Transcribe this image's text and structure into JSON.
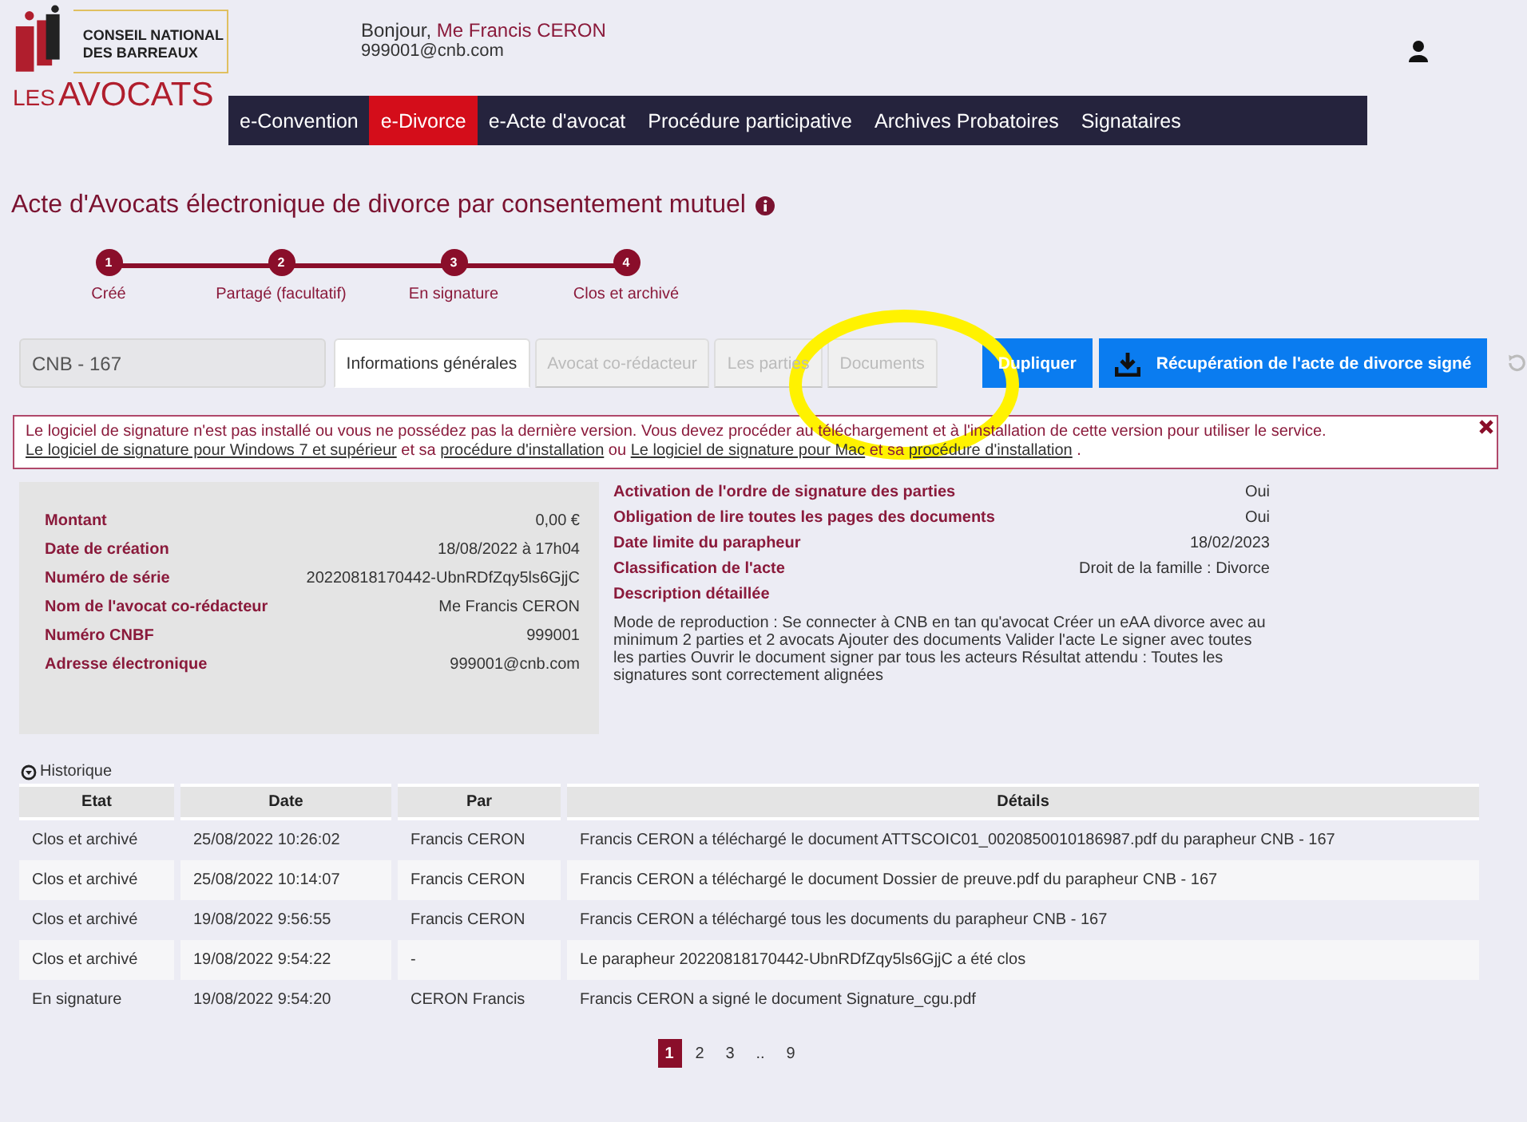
{
  "logo": {
    "line_1": "CONSEIL NATIONAL",
    "line_2": "DES BARREAUX",
    "brand_small": "LES",
    "brand_large": "AVOCATS"
  },
  "user": {
    "greeting": "Bonjour,",
    "name": "Me Francis CERON",
    "email": "999001@cnb.com"
  },
  "nav": [
    {
      "label": "e-Convention",
      "selected": false
    },
    {
      "label": "e-Divorce",
      "selected": true
    },
    {
      "label": "e-Acte d'avocat",
      "selected": false
    },
    {
      "label": "Procédure participative",
      "selected": false
    },
    {
      "label": "Archives Probatoires",
      "selected": false
    },
    {
      "label": "Signataires",
      "selected": false
    }
  ],
  "page_title": "Acte d'Avocats électronique de divorce par consentement mutuel",
  "steps": [
    {
      "number": "1",
      "label": "Créé"
    },
    {
      "number": "2",
      "label": "Partagé (facultatif)"
    },
    {
      "number": "3",
      "label": "En signature"
    },
    {
      "number": "4",
      "label": "Clos et archivé"
    }
  ],
  "reference_field": {
    "value": "CNB - 167"
  },
  "tabs": [
    {
      "label": "Informations générales",
      "selected": true,
      "disabled": false
    },
    {
      "label": "Avocat co-rédacteur",
      "selected": false,
      "disabled": true
    },
    {
      "label": "Les parties",
      "selected": false,
      "disabled": true
    },
    {
      "label": "Documents",
      "selected": false,
      "disabled": true
    }
  ],
  "actions": [
    {
      "label": "Dupliquer",
      "kind": "plain"
    },
    {
      "label": "Récupération de l'acte de divorce signé",
      "kind": "download"
    }
  ],
  "alert": {
    "parts": [
      {
        "text": "Le logiciel de signature n'est pas installé ou vous ne possédez pas la dernière version. Vous devez procéder au téléchargement et à l'installation de cette version pour utiliser le service.",
        "kind": "text"
      },
      {
        "text": "Le logiciel de signature pour Windows 7 et supérieur",
        "kind": "link"
      },
      {
        "text": "et sa",
        "kind": "text"
      },
      {
        "text": "procédure d'installation",
        "kind": "link"
      },
      {
        "text": "ou",
        "kind": "text"
      },
      {
        "text": "Le logiciel de signature pour Mac",
        "kind": "link"
      },
      {
        "text": "et sa",
        "kind": "text"
      },
      {
        "text": "procédure d'installation",
        "kind": "link"
      },
      {
        "text": ".",
        "kind": "text"
      }
    ]
  },
  "details_left": [
    {
      "label": "Montant",
      "value": "0,00 €"
    },
    {
      "label": "Date de création",
      "value": "18/08/2022  à  17h04"
    },
    {
      "label": "Numéro de série",
      "value": "20220818170442-UbnRDfZqy5ls6GjjC"
    },
    {
      "label": "Nom de l'avocat co-rédacteur",
      "value": "Me Francis CERON"
    },
    {
      "label": "Numéro CNBF",
      "value": "999001"
    },
    {
      "label": "Adresse électronique",
      "value": "999001@cnb.com"
    }
  ],
  "details_right": [
    {
      "label": "Activation de l'ordre de signature des parties",
      "value": "Oui"
    },
    {
      "label": "Obligation de lire toutes les pages des documents",
      "value": "Oui"
    },
    {
      "label": "Date limite du parapheur",
      "value": "18/02/2023"
    },
    {
      "label": "Classification de l'acte",
      "value": "Droit de la famille : Divorce"
    },
    {
      "label": "Description détaillée"
    }
  ],
  "description": "Mode de reproduction : Se connecter à CNB en tan qu'avocat Créer un eAA divorce avec au minimum 2 parties et 2 avocats Ajouter des documents Valider l'acte Le signer avec toutes les parties Ouvrir le document signer par tous les acteurs Résultat attendu : Toutes les signatures sont correctement alignées",
  "history": {
    "title": "Historique",
    "columns": [
      "Etat",
      "Date",
      "Par",
      "Détails"
    ],
    "rows": [
      [
        "Clos et archivé",
        "25/08/2022 10:26:02",
        "Francis CERON",
        "Francis CERON a téléchargé le document ATTSCOIC01_0020850010186987.pdf du parapheur CNB - 167"
      ],
      [
        "Clos et archivé",
        "25/08/2022 10:14:07",
        "Francis CERON",
        "Francis CERON a téléchargé le document Dossier de preuve.pdf du parapheur CNB - 167"
      ],
      [
        "Clos et archivé",
        "19/08/2022 9:56:55",
        "Francis CERON",
        "Francis CERON a téléchargé tous les documents du parapheur CNB - 167"
      ],
      [
        "Clos et archivé",
        "19/08/2022 9:54:22",
        "-",
        "Le parapheur 20220818170442-UbnRDfZqy5ls6GjjC a été clos"
      ],
      [
        "En signature",
        "19/08/2022 9:54:20",
        "CERON Francis",
        "Francis CERON a signé le document Signature_cgu.pdf"
      ]
    ]
  },
  "pagination": [
    {
      "label": "1",
      "selected": true
    },
    {
      "label": "2",
      "selected": false
    },
    {
      "label": "3",
      "selected": false
    },
    {
      "label": "..",
      "selected": false
    },
    {
      "label": "9",
      "selected": false
    }
  ],
  "annotation": {
    "kind": "ellipse"
  }
}
